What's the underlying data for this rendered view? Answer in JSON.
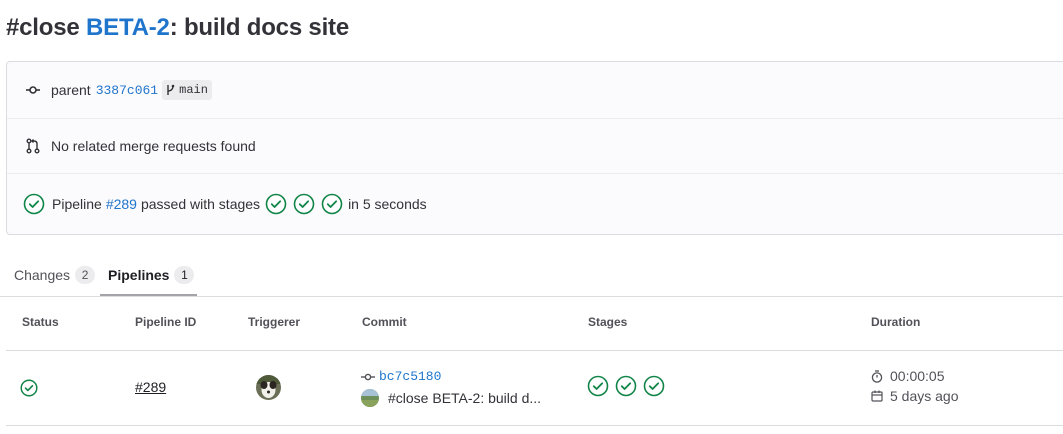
{
  "commit": {
    "title_prefix": "#close ",
    "title_link": "BETA-2",
    "title_suffix": ": build docs site"
  },
  "info": {
    "parent_label": "parent",
    "parent_sha": "3387c061",
    "branch": "main",
    "merge_requests_text": "No related merge requests found",
    "pipeline_prefix": "Pipeline",
    "pipeline_id": "#289",
    "pipeline_middle": "passed with stages",
    "pipeline_suffix": "in 5 seconds"
  },
  "tabs": [
    {
      "label": "Changes",
      "count": "2",
      "active": false
    },
    {
      "label": "Pipelines",
      "count": "1",
      "active": true
    }
  ],
  "table": {
    "headers": [
      "Status",
      "Pipeline ID",
      "Triggerer",
      "Commit",
      "Stages",
      "Duration"
    ],
    "rows": [
      {
        "status": "passed",
        "pipeline_id": "#289",
        "commit_sha": "bc7c5180",
        "commit_message": "#close BETA-2: build d...",
        "duration": "00:00:05",
        "finished": "5 days ago"
      }
    ]
  },
  "colors": {
    "success": "#108548",
    "link": "#1f75cb"
  },
  "icons": {
    "commit": "commit-icon",
    "branch": "branch-icon",
    "merge_request": "merge-request-icon",
    "status_success": "status-success-icon",
    "timer": "timer-icon",
    "calendar": "calendar-icon"
  }
}
